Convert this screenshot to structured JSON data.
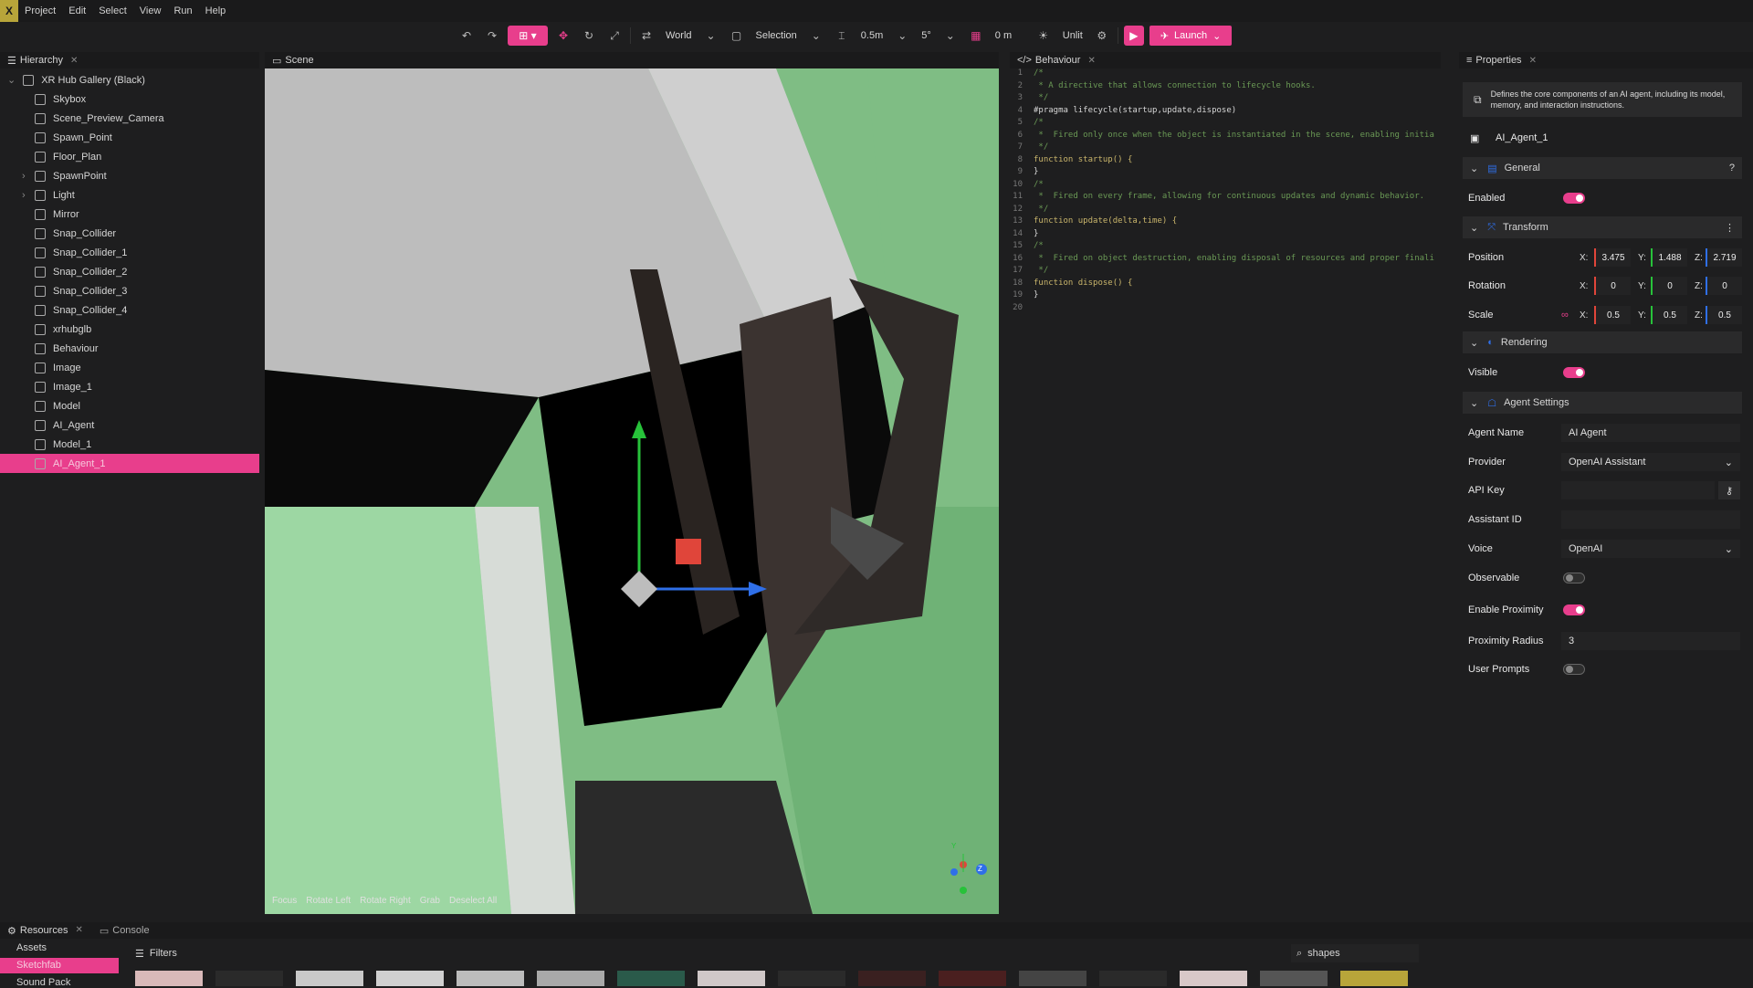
{
  "menu": {
    "logo": "X",
    "items": [
      "Project",
      "Edit",
      "Select",
      "View",
      "Run",
      "Help"
    ]
  },
  "toolbar": {
    "coordinate_space": "World",
    "selection_mode": "Selection",
    "snap_distance": "0.5m",
    "angle": "5°",
    "grid_value": "0 m",
    "lighting": "Unlit",
    "launch_label": "Launch"
  },
  "hierarchy": {
    "tab": "Hierarchy",
    "root": "XR Hub Gallery (Black)",
    "items": [
      "Skybox",
      "Scene_Preview_Camera",
      "Spawn_Point",
      "Floor_Plan",
      "SpawnPoint",
      "Light",
      "Mirror",
      "Snap_Collider",
      "Snap_Collider_1",
      "Snap_Collider_2",
      "Snap_Collider_3",
      "Snap_Collider_4",
      "xrhubglb",
      "Behaviour",
      "Image",
      "Image_1",
      "Model",
      "AI_Agent",
      "Model_1",
      "AI_Agent_1"
    ],
    "selected": "AI_Agent_1"
  },
  "scene": {
    "tab": "Scene",
    "hints": [
      "Focus",
      "Rotate Left",
      "Rotate Right",
      "Grab",
      "Deselect All"
    ],
    "gizmo_axes": [
      "Y",
      "Z"
    ]
  },
  "behaviour": {
    "tab": "Behaviour",
    "lines": [
      "/*",
      " * A directive that allows connection to lifecycle hooks.",
      " */",
      "#pragma lifecycle(startup,update,dispose)",
      "/*",
      " *  Fired only once when the object is instantiated in the scene, enabling initia",
      " */",
      "function startup() {",
      "}",
      "/*",
      " *  Fired on every frame, allowing for continuous updates and dynamic behavior.",
      " */",
      "function update(delta,time) {",
      "}",
      "/*",
      " *  Fired on object destruction, enabling disposal of resources and proper finali",
      " */",
      "function dispose() {",
      "}",
      ""
    ]
  },
  "properties": {
    "tab": "Properties",
    "description": "Defines the core components of an AI agent, including its model, memory, and interaction instructions.",
    "object_name": "AI_Agent_1",
    "general": "General",
    "enabled_label": "Enabled",
    "transform": "Transform",
    "position_label": "Position",
    "position": {
      "x": "3.475",
      "y": "1.488",
      "z": "2.719"
    },
    "rotation_label": "Rotation",
    "rotation": {
      "x": "0",
      "y": "0",
      "z": "0"
    },
    "scale_label": "Scale",
    "scale": {
      "x": "0.5",
      "y": "0.5",
      "z": "0.5"
    },
    "axis_x": "X:",
    "axis_y": "Y:",
    "axis_z": "Z:",
    "rendering": "Rendering",
    "visible_label": "Visible",
    "agent_settings": "Agent Settings",
    "agent_name_label": "Agent Name",
    "agent_name": "AI Agent",
    "provider_label": "Provider",
    "provider": "OpenAI Assistant",
    "api_key_label": "API Key",
    "assistant_id_label": "Assistant ID",
    "voice_label": "Voice",
    "voice": "OpenAI",
    "observable_label": "Observable",
    "enable_proximity_label": "Enable Proximity",
    "proximity_radius_label": "Proximity Radius",
    "proximity_radius": "3",
    "user_prompts_label": "User Prompts"
  },
  "bottom": {
    "tab_resources": "Resources",
    "tab_console": "Console",
    "nav": [
      "Assets",
      "Sketchfab",
      "Sound Pack"
    ],
    "filters": "Filters",
    "search": "shapes"
  },
  "colors": {
    "accent": "#e83e8c",
    "axis_x": "#e0453a",
    "axis_y": "#27c23a",
    "axis_z": "#2f6fe8"
  }
}
